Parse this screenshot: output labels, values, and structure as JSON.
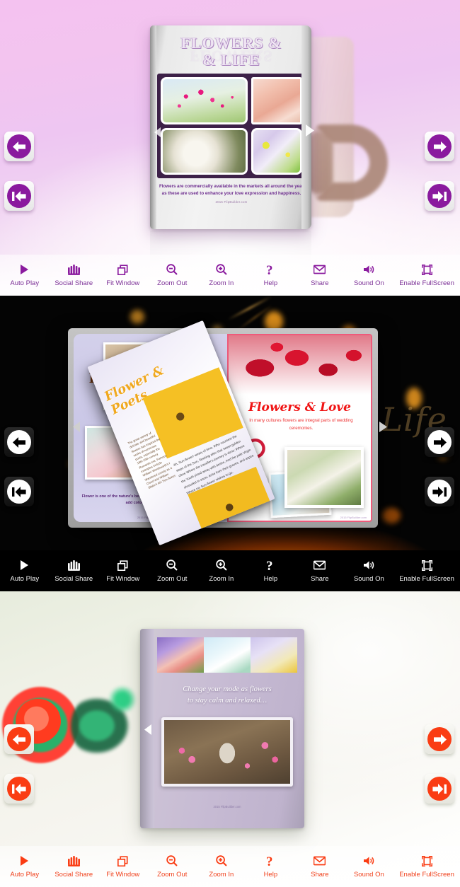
{
  "toolbar": {
    "items": [
      {
        "label": "Auto Play",
        "icon": "play-icon"
      },
      {
        "label": "Social Share",
        "icon": "social-share-icon"
      },
      {
        "label": "Fit Window",
        "icon": "fit-window-icon"
      },
      {
        "label": "Zoom Out",
        "icon": "zoom-out-icon"
      },
      {
        "label": "Zoom In",
        "icon": "zoom-in-icon"
      },
      {
        "label": "Help",
        "icon": "help-icon"
      },
      {
        "label": "Share",
        "icon": "envelope-icon"
      },
      {
        "label": "Sound On",
        "icon": "speaker-icon"
      },
      {
        "label": "Enable FullScreen",
        "icon": "fullscreen-icon"
      }
    ]
  },
  "nav": {
    "previous_page": "Previous Page",
    "next_page": "Next Page",
    "first_page": "First Page",
    "last_page": "Last Page"
  },
  "themes": [
    {
      "name": "Purple Mug Theme",
      "accent": "#8a1a9e",
      "background": "#f3c4ef",
      "toolbar_text": "#7b2f96"
    },
    {
      "name": "Black Bokeh Theme",
      "accent": "#ffffff",
      "background": "#040404",
      "toolbar_text": "#f2f2f2"
    },
    {
      "name": "Red Fresh Theme",
      "accent": "#fa3c13",
      "background": "#eff1e6",
      "toolbar_text": "#f0411c"
    }
  ],
  "book_purple": {
    "title_line1": "FLOWERS &",
    "title_line2": "& LIFE",
    "title_ghost": "FLOWERS",
    "title_ghost2": "LIFE",
    "caption": "Flowers are commercially available in the markets all around the year as these are used to enhance your love expression and happiness.",
    "brand": "2015 FlipBuilder.com",
    "photos": [
      "pink-cosmos",
      "peach-rose",
      "white-roses",
      "purple-daisy"
    ]
  },
  "book_black": {
    "left_title": "Flow",
    "left_caption": "Flower is one of the nature's best gift to mankind, it is so colorful that it can add colors in life of people.",
    "left_brand": "2015 FlipBuilder.com",
    "right_title": "Flowers & Love",
    "right_subtitle": "In many cultures flowers are integral parts of wedding ceremonies.",
    "right_brand": "2015 FlipBuilder.com",
    "fly_title": "Flower & Poets",
    "fly_column": "The great variety of delicate and beautiful flowers has inspired the works of numerous poets, especially the 18th-19th century Romantic era. Famous examples include William Wordsworth's I Wandered Lonely as a Cloud and William Blake's Ah! Sun-flower.",
    "fly_poem": "Ah, Sun-flower! weary of time, Who countest the steps of the Sun, Seeking after that sweet golden clime Where the traveller's journey is done; Where the Youth pined away with desire, And the pale Virgin shrouded in snow, Arise from their graves, and aspire Where my Sun-flower wishes to go.",
    "watermark": "Life"
  },
  "book_red": {
    "quote_line1": "Change your mode as flowers",
    "quote_line2": "to stay calm and relaxed…",
    "brand": "2015 FlipBuilder.com",
    "photos": [
      "purple-roses",
      "white-daisy",
      "lavender-petals",
      "bird-on-blossom"
    ]
  }
}
